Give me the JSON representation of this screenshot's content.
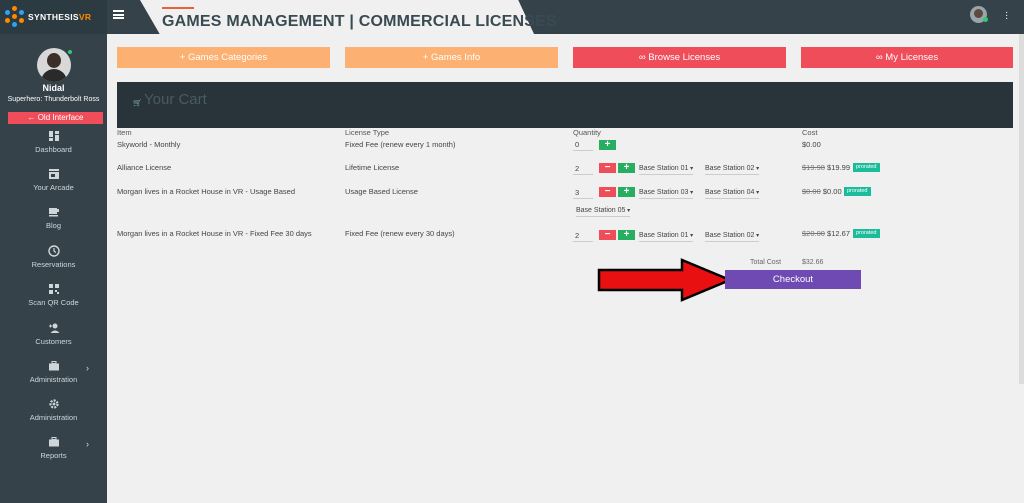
{
  "brand": {
    "name_a": "SYNTHESIS",
    "name_b": "VR"
  },
  "page": {
    "title": "GAMES MANAGEMENT | COMMERCIAL LICENSES"
  },
  "user": {
    "name": "Nidal",
    "title": "Superhero: Thunderbolt Ross",
    "status_color": "#2ecc71"
  },
  "sidebar": {
    "old_interface": "← Old Interface",
    "items": [
      {
        "label": "Dashboard",
        "icon": "dashboard-icon"
      },
      {
        "label": "Your Arcade",
        "icon": "store-icon"
      },
      {
        "label": "Blog",
        "icon": "coffee-icon"
      },
      {
        "label": "Reservations",
        "icon": "clock-icon"
      },
      {
        "label": "Scan QR Code",
        "icon": "qr-code-icon"
      },
      {
        "label": "Customers",
        "icon": "add-person-icon"
      },
      {
        "label": "Administration",
        "icon": "briefcase-icon"
      },
      {
        "label": "Administration",
        "icon": "gear-icon"
      },
      {
        "label": "Reports",
        "icon": "briefcase-icon"
      }
    ]
  },
  "tabs": [
    {
      "label": "Games Categories",
      "prefix": "+"
    },
    {
      "label": "Games Info",
      "prefix": "+"
    },
    {
      "label": "Browse Licenses",
      "prefix": "∞"
    },
    {
      "label": "My Licenses",
      "prefix": "∞"
    }
  ],
  "cart": {
    "title": "Your Cart",
    "columns": {
      "item": "Item",
      "license": "License Type",
      "quantity": "Quantity",
      "cost": "Cost"
    },
    "rows": [
      {
        "item": "Skyworld - Monthly",
        "license": "Fixed Fee (renew every 1 month)",
        "qty": "0",
        "cost": "$0.00"
      },
      {
        "item": "Alliance License",
        "license": "Lifetime License",
        "qty": "2",
        "stations": [
          "Base Station 01",
          "Base Station 02"
        ],
        "old_cost": "$19.98",
        "cost": "$19.99",
        "badge": "prorated"
      },
      {
        "item": "Morgan lives in a Rocket House in VR - Usage Based",
        "license": "Usage Based License",
        "qty": "3",
        "stations": [
          "Base Station 03",
          "Base Station 04",
          "Base Station 05"
        ],
        "old_cost": "$0.00",
        "cost": "$0.00",
        "badge": "prorated"
      },
      {
        "item": "Morgan lives in a Rocket House in VR - Fixed Fee 30 days",
        "license": "Fixed Fee (renew every 30 days)",
        "qty": "2",
        "stations": [
          "Base Station 01",
          "Base Station 02"
        ],
        "old_cost": "$20.00",
        "cost": "$12.67",
        "badge": "prorated"
      }
    ],
    "total_label": "Total Cost",
    "total_value": "$32.66",
    "checkout": "Checkout"
  },
  "colors": {
    "orange": "#fcb072",
    "red": "#f04d5a",
    "green": "#27ae60",
    "purple": "#6f4ab3",
    "dark": "#35424a"
  }
}
